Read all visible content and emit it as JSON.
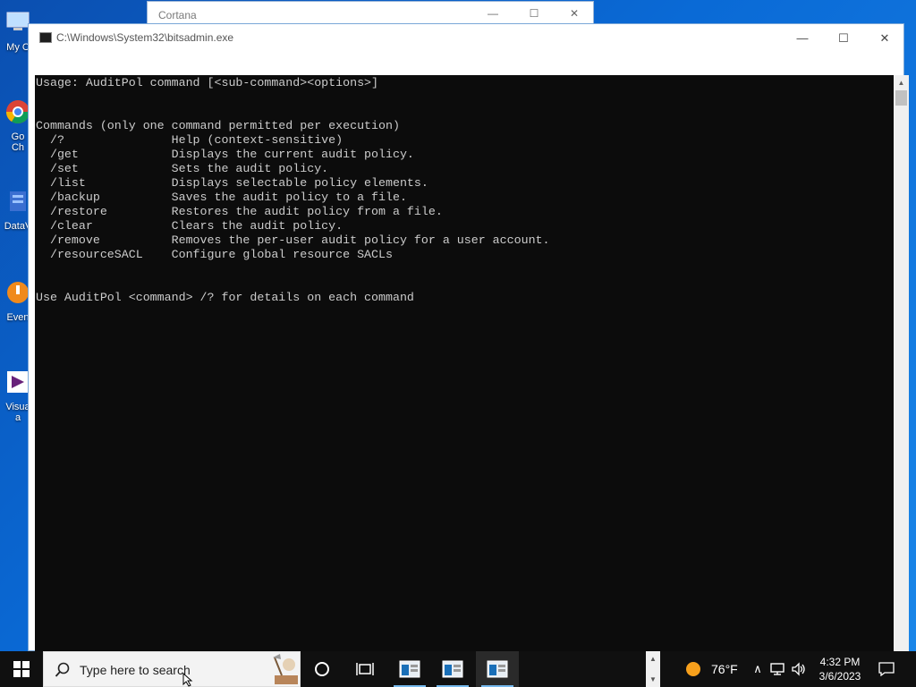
{
  "desktop": {
    "icons": [
      {
        "label": "My C",
        "icon": "computer-icon"
      },
      {
        "label": "Go\nCh",
        "icon": "chrome-icon"
      },
      {
        "label": "DataV",
        "icon": "datavault-icon"
      },
      {
        "label": "Even",
        "icon": "event-icon"
      },
      {
        "label": "Visua\na",
        "icon": "visual-studio-icon"
      }
    ]
  },
  "cortana_window": {
    "title": "Cortana"
  },
  "console_window": {
    "title": "C:\\Windows\\System32\\bitsadmin.exe",
    "output": "Usage: AuditPol command [<sub-command><options>]\n\n\nCommands (only one command permitted per execution)\n  /?               Help (context-sensitive)\n  /get             Displays the current audit policy.\n  /set             Sets the audit policy.\n  /list            Displays selectable policy elements.\n  /backup          Saves the audit policy to a file.\n  /restore         Restores the audit policy from a file.\n  /clear           Clears the audit policy.\n  /remove          Removes the per-user audit policy for a user account.\n  /resourceSACL    Configure global resource SACLs\n\n\nUse AuditPol <command> /? for details on each command"
  },
  "taskbar": {
    "search_placeholder": "Type here to search",
    "weather": "76°F",
    "time": "4:32 PM",
    "date": "3/6/2023"
  },
  "colors": {
    "console_bg": "#0c0c0c",
    "console_text": "#cccccc",
    "taskbar_bg": "#101010",
    "desktop_bg": "#0a6ad6"
  }
}
